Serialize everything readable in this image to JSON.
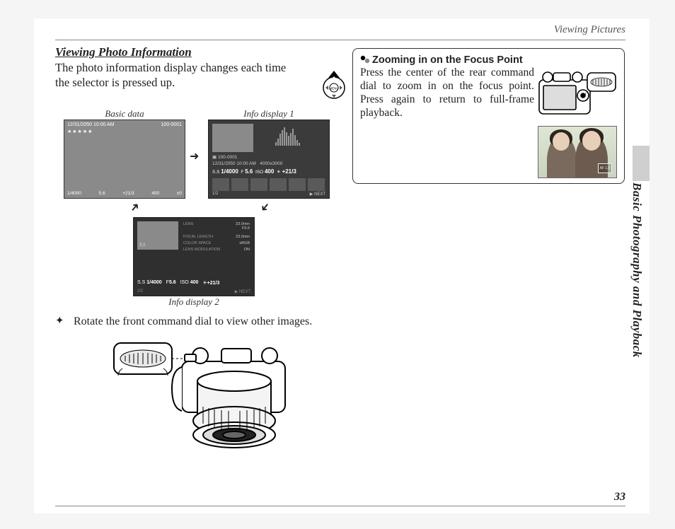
{
  "header": {
    "section": "Viewing Pictures"
  },
  "sidebar": {
    "chapter": "Basic Photography and Playback"
  },
  "page_number": "33",
  "left": {
    "title": "Viewing Photo Information",
    "intro": "The photo information display changes each time the selector is pressed up.",
    "labels": {
      "basic": "Basic data",
      "info1": "Info display 1",
      "info2": "Info display 2"
    },
    "screen1": {
      "date": "12/31/2050 10:00 AM",
      "frame": "100-0001",
      "stars": "★★★★★",
      "shutter": "1/4000",
      "aperture": "5.6",
      "ev": "+21/3",
      "iso": "400",
      "flash": "±0"
    },
    "screen2": {
      "frame": "100-0001",
      "date": "12/31/2050 10:00 AM",
      "dims": "4000x3000",
      "ss_lbl": "S.S",
      "ss": "1/4000",
      "f_lbl": "F",
      "f": "5.6",
      "iso_lbl": "ISO",
      "iso": "400",
      "ev": "+21/3",
      "page": "1/2",
      "next": "NEXT"
    },
    "screen3": {
      "ratio": "3:2",
      "k_lens": "LENS",
      "k_fl": "FOCAL LENGTH",
      "k_cs": "COLOR SPACE",
      "k_lm": "LENS MODULATION",
      "v_lens": "23.0mm\nF5.6",
      "v_fl": "23.0mm",
      "v_cs": "sRGB",
      "v_lm": "ON",
      "ss_lbl": "S.S",
      "ss": "1/4000",
      "f_lbl": "F",
      "f": "5.6",
      "iso_lbl": "ISO",
      "iso": "400",
      "ev": "+21/3",
      "page": "2/2",
      "next": "NEXT"
    },
    "tip": "Rotate the front command dial to view other images."
  },
  "right": {
    "note_title": "Zooming in on the Focus Point",
    "note_body": "Press the center of the rear command dial to zoom in on the focus point.  Press again to return to full-frame playback.",
    "af_label": "AF 1.0"
  }
}
